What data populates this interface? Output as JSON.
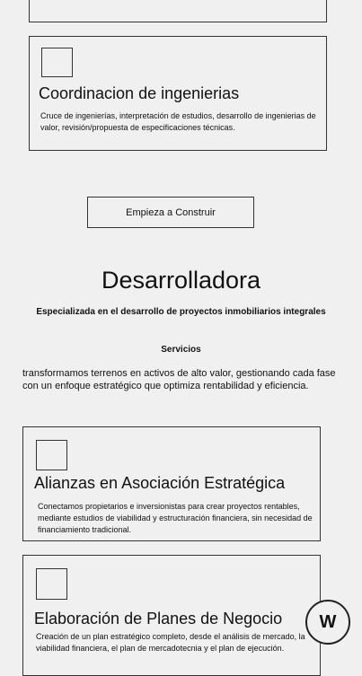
{
  "card_coordinacion": {
    "title": "Coordinacion de ingenierias",
    "text": "Cruce de ingenierías, interpretación de estudios, desarrollo de ingenierias de valor, revisión/propuesta de especificaciones técnicas."
  },
  "cta": {
    "label": "Empieza a Construir"
  },
  "section": {
    "title": "Desarrolladora",
    "subtitle": "Especializada en el desarrollo de proyectos inmobiliarios integrales",
    "services_heading": "Servicios",
    "description": "transformamos terrenos en activos de alto valor, gestionando cada fase con un enfoque estratégico que optimiza rentabilidad y eficiencia."
  },
  "card_alianzas": {
    "title": "Alianzas en Asociación Estratégica",
    "text": "Conectamos propietarios e inversionistas para crear proyectos rentables, mediante estudios de viabilidad y estructuración financiera, sin necesidad de financiamiento tradicional."
  },
  "card_planes": {
    "title": "Elaboración de Planes de Negocio",
    "text": "Creación de un plan estratégico completo, desde el análisis de mercado, la viabilidad financiera, el plan de mercadotecnia y el plan de ejecución."
  },
  "badge": {
    "label": "W"
  }
}
